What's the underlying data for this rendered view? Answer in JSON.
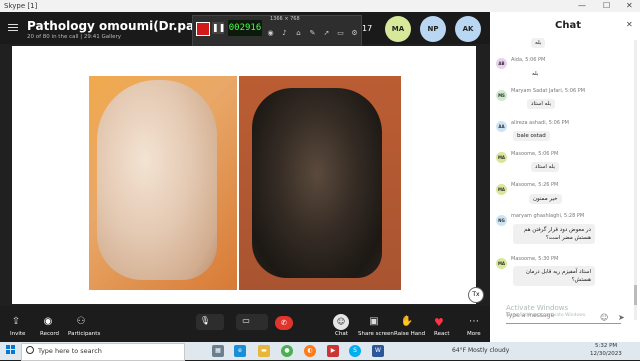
{
  "window": {
    "app_title": "Skype [1]",
    "controls": [
      "—",
      "☐",
      "✕"
    ]
  },
  "call": {
    "title": "Pathology omoumi(Dr.panahi)",
    "subtitle": "20 of 80 in the call | 29:41  Gallery",
    "timer": "002916",
    "recorder_size_label": "1366 × 768",
    "participants_overflow": "17",
    "avatars": [
      {
        "initials": "MA",
        "color": "#d8e89a"
      },
      {
        "initials": "NP",
        "color": "#b9d7f2"
      },
      {
        "initials": "AK",
        "color": "#b9d7f2"
      }
    ],
    "badge": "Tx"
  },
  "controls": {
    "invite": "Invite",
    "record": "Record",
    "participants": "Participants",
    "chat": "Chat",
    "share_screen": "Share screen",
    "raise_hand": "Raise Hand",
    "react": "React",
    "more": "More"
  },
  "chat": {
    "title": "Chat",
    "messages": [
      {
        "initials": "",
        "name": "",
        "text": "بله"
      },
      {
        "initials": "AB",
        "name": "Aida, 5:06 PM",
        "text": "بله"
      },
      {
        "initials": "MS",
        "name": "Maryam Sadat Jafari, 5:06 PM",
        "text": "بله استاد"
      },
      {
        "initials": "AA",
        "name": "alireza ashadi, 5:06 PM",
        "text": "bale ostad"
      },
      {
        "initials": "MA",
        "name": "Masoome, 5:06 PM",
        "text": "بله استاد"
      },
      {
        "initials": "MA",
        "name": "Masoome, 5:26 PM",
        "text": "خیر ممنون"
      },
      {
        "initials": "NG",
        "name": "maryam ghashlaghi, 5:28 PM",
        "text": "در معوض دود قرار گرفتن هم هستش مضر است؟"
      },
      {
        "initials": "MA",
        "name": "Masoome, 5:30 PM",
        "text": "استاد آمفیزم ریه قابل درمان هستش؟"
      }
    ],
    "input_placeholder": "Type a message",
    "watermark_line1": "Activate Windows",
    "watermark_line2": "Go to Settings to activate Windows."
  },
  "taskbar": {
    "search_placeholder": "Type here to search",
    "weather": "64°F  Mostly cloudy",
    "time": "5:32 PM",
    "date": "12/30/2023",
    "apps": [
      {
        "name": "task-view",
        "color": "#6a7f8f"
      },
      {
        "name": "edge",
        "color": "#1a8fd8"
      },
      {
        "name": "file-explorer",
        "color": "#e8b73a"
      },
      {
        "name": "chrome",
        "color": "#4caf50"
      },
      {
        "name": "firefox",
        "color": "#ff7a1a"
      },
      {
        "name": "media",
        "color": "#c33"
      },
      {
        "name": "skype",
        "color": "#00aff0"
      },
      {
        "name": "word",
        "color": "#2b579a"
      }
    ]
  }
}
